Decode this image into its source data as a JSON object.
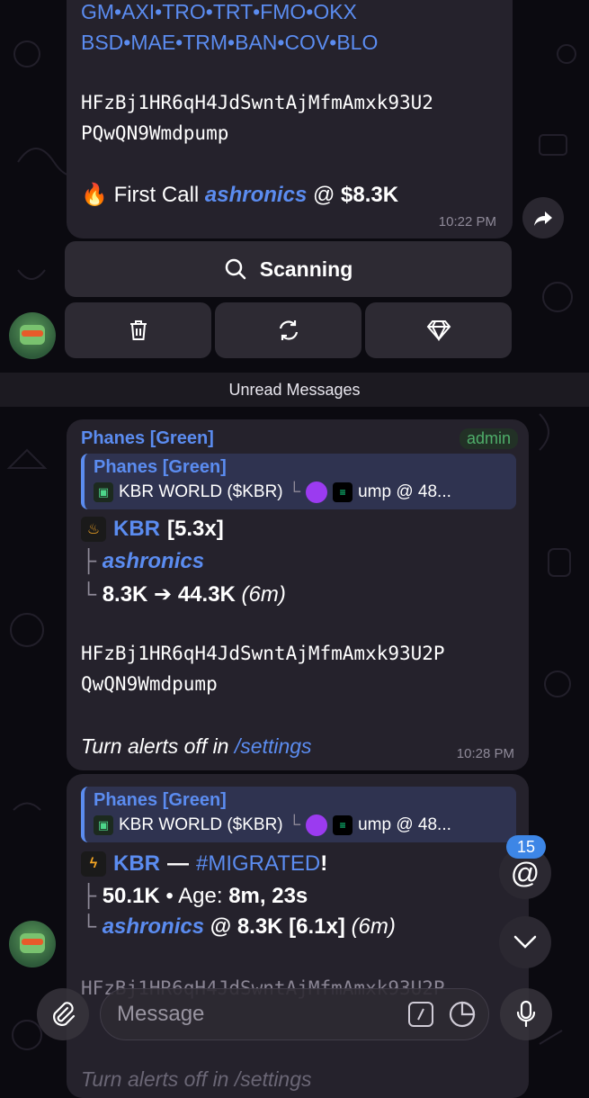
{
  "msg1": {
    "ticker_line1": "GM•AXI•TRO•TRT•FMO•OKX",
    "ticker_line2": "BSD•MAE•TRM•BAN•COV•BLO",
    "address_line1": "HFzBj1HR6qH4JdSwntAjMfmAmxk93U2",
    "address_line2": "PQwQN9Wmdpump",
    "first_call_emoji": "🔥",
    "first_call_label": "First Call",
    "first_call_user": "ashronics",
    "first_call_at": "@",
    "first_call_value": "$8.3K",
    "time": "10:22 PM"
  },
  "buttons": {
    "scanning_label": "Scanning"
  },
  "unread_label": "Unread Messages",
  "msg2": {
    "sender": "Phanes [Green]",
    "badge": "admin",
    "quote_name": "Phanes [Green]",
    "quote_text": "KBR WORLD ($KBR)",
    "quote_sep": "└",
    "quote_tail": "ump @ 48...",
    "headline_token": "KBR",
    "headline_mult": "[5.3x]",
    "tree1_prefix": "├",
    "tree1_user": "ashronics",
    "tree2_prefix": "└",
    "tree2_text": "8.3K ➔ 44.3K",
    "tree2_time": "(6m)",
    "address_line1": "HFzBj1HR6qH4JdSwntAjMfmAmxk93U2P",
    "address_line2": "QwQN9Wmdpump",
    "footer_prefix": "Turn alerts off in",
    "footer_link": "/settings",
    "time": "10:28 PM"
  },
  "msg3": {
    "quote_name": "Phanes [Green]",
    "quote_text": "KBR WORLD ($KBR)",
    "quote_sep": "└",
    "quote_tail": "ump @ 48...",
    "headline_token": "KBR",
    "headline_dash": "—",
    "headline_tag": "#MIGRATED",
    "headline_bang": "!",
    "row1_prefix": "├",
    "row1_value": "50.1K",
    "row1_dot": "•",
    "row1_age_label": "Age:",
    "row1_age_value": "8m, 23s",
    "row2_prefix": "└",
    "row2_user": "ashronics",
    "row2_text": "@ 8.3K [6.1x]",
    "row2_time": "(6m)",
    "address_partial": "HFzBj1HR6qH4JdSwntAjMfmAmxk93U2P",
    "footer_partial": "Turn alerts off in /settings"
  },
  "mentions_count": "15",
  "input": {
    "placeholder": "Message"
  }
}
